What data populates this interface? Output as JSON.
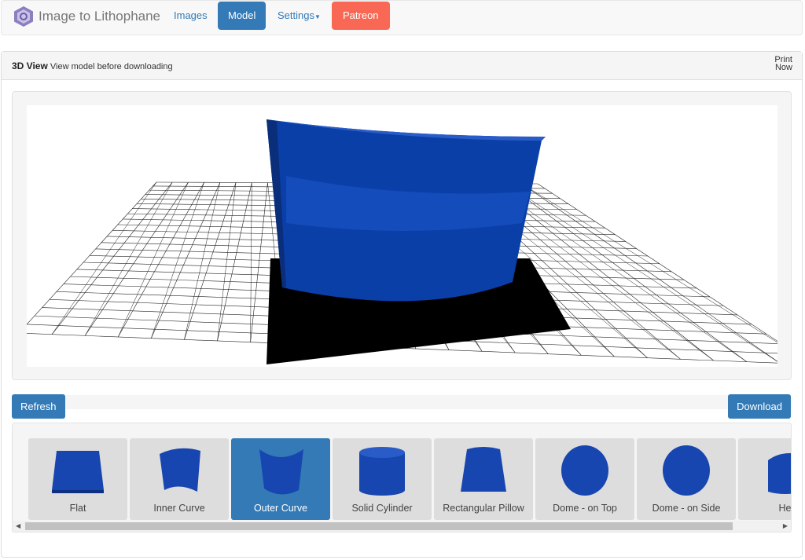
{
  "navbar": {
    "brand": "Image to Lithophane",
    "items": [
      {
        "label": "Images"
      },
      {
        "label": "Model",
        "active": true
      },
      {
        "label": "Settings"
      },
      {
        "label": "Patreon"
      }
    ]
  },
  "panel": {
    "title": "3D View",
    "subtitle": "View model before downloading",
    "print_line1": "Print",
    "print_line2": "Now"
  },
  "actions": {
    "refresh": "Refresh",
    "download": "Download"
  },
  "models": [
    {
      "label": "Flat",
      "icon": "flat"
    },
    {
      "label": "Inner Curve",
      "icon": "inner-curve"
    },
    {
      "label": "Outer Curve",
      "icon": "outer-curve",
      "selected": true
    },
    {
      "label": "Solid Cylinder",
      "icon": "cylinder"
    },
    {
      "label": "Rectangular Pillow",
      "icon": "pillow"
    },
    {
      "label": "Dome - on Top",
      "icon": "dome"
    },
    {
      "label": "Dome - on Side",
      "icon": "dome"
    },
    {
      "label": "Hea",
      "icon": "heart"
    }
  ],
  "colors": {
    "primary": "#337ab7",
    "patreon": "#f96854",
    "model": "#0a3fa8"
  }
}
